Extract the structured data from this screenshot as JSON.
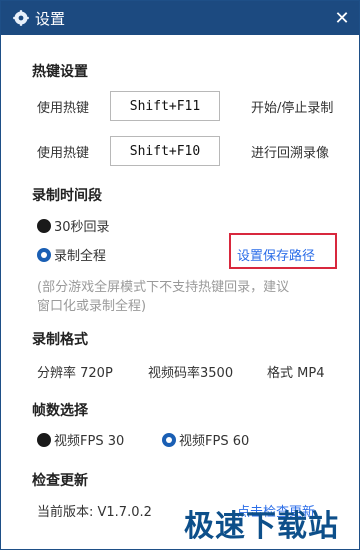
{
  "window": {
    "title": "设置",
    "close_symbol": "✕"
  },
  "hotkeys": {
    "section_title": "热键设置",
    "rows": [
      {
        "label": "使用热键",
        "key": "Shift+F11",
        "action": "开始/停止录制"
      },
      {
        "label": "使用热键",
        "key": "Shift+F10",
        "action": "进行回溯录像"
      }
    ]
  },
  "record_time": {
    "section_title": "录制时间段",
    "options": [
      {
        "label": "30秒回录",
        "selected": false
      },
      {
        "label": "录制全程",
        "selected": true
      }
    ],
    "save_path_link": "设置保存路径",
    "note_line1": "(部分游戏全屏模式下不支持热键回录，建议",
    "note_line2": "窗口化或录制全程)"
  },
  "format": {
    "section_title": "录制格式",
    "resolution": "分辨率 720P",
    "bitrate": "视频码率3500",
    "container": "格式 MP4"
  },
  "fps": {
    "section_title": "帧数选择",
    "options": [
      {
        "label": "视频FPS 30",
        "selected": false
      },
      {
        "label": "视频FPS 60",
        "selected": true
      }
    ]
  },
  "update": {
    "section_title": "检查更新",
    "version": "当前版本: V1.7.0.2",
    "check_link": "点击检查更新"
  },
  "watermark": "极速下载站",
  "colors": {
    "titlebar": "#1c4a80",
    "accent": "#1a5fb4",
    "link": "#2b6de8",
    "highlight": "#d8283d"
  }
}
